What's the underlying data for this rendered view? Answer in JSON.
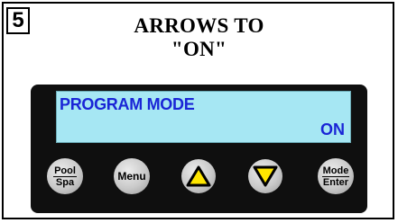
{
  "step_number": "5",
  "heading": {
    "line1": "ARROWS TO",
    "line2": "\"ON\""
  },
  "display": {
    "line1": "PROGRAM MODE",
    "line2": "ON",
    "background_color": "#a6e7f3",
    "text_color": "#1a25d6"
  },
  "buttons": {
    "pool_spa": {
      "top": "Pool",
      "bottom": "Spa"
    },
    "menu": "Menu",
    "up": {
      "icon": "up-arrow-icon",
      "color": "#ffe600"
    },
    "down": {
      "icon": "down-arrow-icon",
      "color": "#ffe600"
    },
    "mode_enter": {
      "top": "Mode",
      "bottom": "Enter"
    }
  }
}
